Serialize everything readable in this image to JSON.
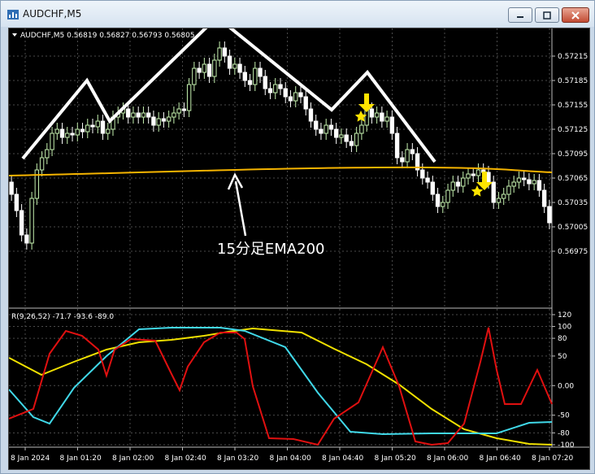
{
  "window": {
    "title": "AUDCHF,M5"
  },
  "chart": {
    "info": "AUDCHF,M5  0.56819 0.56827 0.56793 0.56805",
    "price_labels": [
      "0.57215",
      "0.57185",
      "0.57155",
      "0.57125",
      "0.57095",
      "0.57065",
      "0.57035",
      "0.57005",
      "0.56975"
    ],
    "time_labels": [
      "8 Jan 2024",
      "8 Jan 01:20",
      "8 Jan 02:00",
      "8 Jan 02:40",
      "8 Jan 03:20",
      "8 Jan 04:00",
      "8 Jan 04:40",
      "8 Jan 05:20",
      "8 Jan 06:00",
      "8 Jan 06:40",
      "8 Jan 07:20"
    ],
    "annotation": "15分足EMA200",
    "colors": {
      "candle_up": "#c6f2b0",
      "candle_down": "#ffffff",
      "ema": "#f5b400",
      "overlay": "#ffffff",
      "arrow": "#ffe400",
      "grid": "#4a4a4a"
    },
    "candle_up_note": "green hollow bodies for up candles, white for down"
  },
  "indicator": {
    "header": "R(9,26,52) -71.7 -93.6 -89.0",
    "levels": [
      "120",
      "100",
      "80",
      "50",
      "0.00",
      "-50",
      "-80",
      "-100"
    ],
    "colors": {
      "fast": "#e01010",
      "mid": "#40d8e8",
      "slow": "#f0e000"
    }
  }
}
